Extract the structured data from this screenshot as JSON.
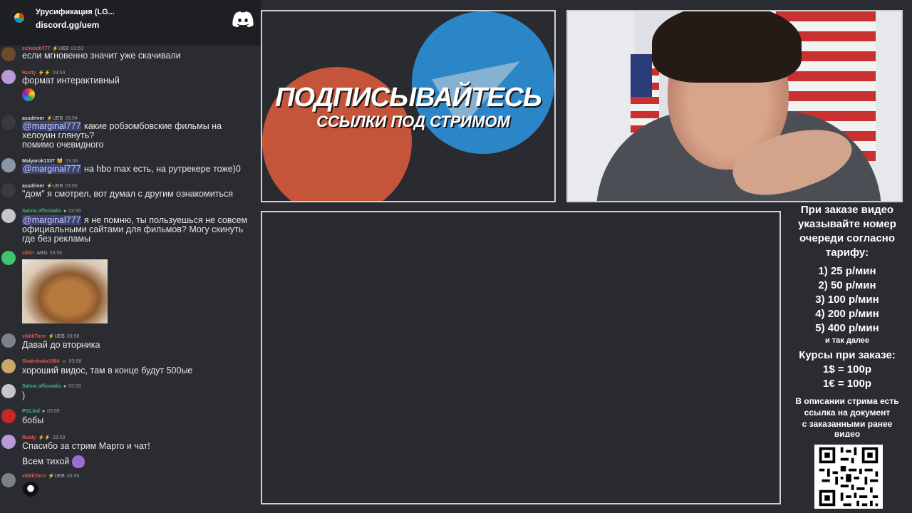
{
  "discord": {
    "server_name": "Урусификация (LG...",
    "invite": "discord.gg/uem",
    "icon": "discord-logo-icon"
  },
  "chat": {
    "messages": [
      {
        "user": "zsheech777",
        "user_color": "#e0584f",
        "badge": "⚡UEB",
        "time": "03:53",
        "lines": [
          "если мгновенно значит уже скачивали"
        ]
      },
      {
        "user": "Rusty",
        "user_color": "#e0584f",
        "badge": "⚡⚡",
        "time": "03:54",
        "lines": [
          "формат интерактивный"
        ],
        "emote": "rainbow-cat-emote"
      },
      {
        "user": "assdriver",
        "user_color": "#dcddde",
        "badge": "⚡UEB",
        "time": "03:54",
        "mention": "@marginal777",
        "lines": [
          " какие робзомбовские фильмы на",
          "хелоуин глянуть?",
          "помимо очевидного"
        ]
      },
      {
        "user": "Malyarok1337",
        "user_color": "#dcddde",
        "badge": "🐱",
        "time": "03:56",
        "mention": "@marginal777",
        "lines": [
          " на hbo max есть, на рутрекере тоже)0"
        ]
      },
      {
        "user": "assdriver",
        "user_color": "#dcddde",
        "badge": "⚡UEB",
        "time": "03:56",
        "lines": [
          "\"дом\" я смотрел, вот думал с другим ознакомиться"
        ]
      },
      {
        "user": "Salvia officinalis",
        "user_color": "#43b581",
        "badge": "●",
        "time": "03:56",
        "mention": "@marginal777",
        "lines": [
          " я не помню, ты пользуешься не совсем",
          "официальными сайтами для фильмов? Могу скинуть",
          "где без рекламы"
        ]
      },
      {
        "user": "slitirr",
        "user_color": "#e0584f",
        "badge": "ARG",
        "time": "03:56",
        "lines": [],
        "image": "kitten-image"
      },
      {
        "user": "vikkkTorrr",
        "user_color": "#e0584f",
        "badge": "⚡UEB",
        "time": "03:58",
        "lines": [
          "Давай до вторника"
        ]
      },
      {
        "user": "Shakshuka1984",
        "user_color": "#e0584f",
        "badge": "☺",
        "time": "03:58",
        "lines": [
          "хороший видос, там в конце будут 500ые"
        ]
      },
      {
        "user": "Salvia officinalis",
        "user_color": "#43b581",
        "badge": "●",
        "time": "03:59",
        "lines": [
          ")"
        ]
      },
      {
        "user": "PGLind",
        "user_color": "#43b581",
        "badge": "●",
        "time": "03:59",
        "lines": [
          "бобы"
        ]
      },
      {
        "user": "Rusty",
        "user_color": "#e0584f",
        "badge": "⚡⚡",
        "time": "03:59",
        "lines": [
          "Спасибо за стрим Марго и чат!",
          "Всем тихой"
        ],
        "emote": "purple-heart-emote"
      },
      {
        "user": "vikkkTorrr",
        "user_color": "#e0584f",
        "badge": "⚡UEB",
        "time": "03:59",
        "lines": [],
        "emote": "bird-emote"
      }
    ]
  },
  "promo": {
    "title": "ПОДПИСЫВАЙТЕСЬ",
    "subtitle": "ССЫЛКИ ПОД СТРИМОМ"
  },
  "info": {
    "order_heading": [
      "При заказе видео",
      "указывайте номер",
      "очереди согласно",
      "тарифу:"
    ],
    "tariffs": [
      "1) 25 р/мин",
      "2) 50 р/мин",
      "3) 100 р/мин",
      "4) 200 р/мин",
      "5) 400 р/мин"
    ],
    "tariffs_more": "и так далее",
    "rates_heading": "Курсы при заказе:",
    "rates": [
      "1$ = 100р",
      "1€ = 100р"
    ],
    "description_note": [
      "В описании стрима есть",
      "ссылка на документ",
      "с заказанными ранее",
      "видео"
    ]
  }
}
